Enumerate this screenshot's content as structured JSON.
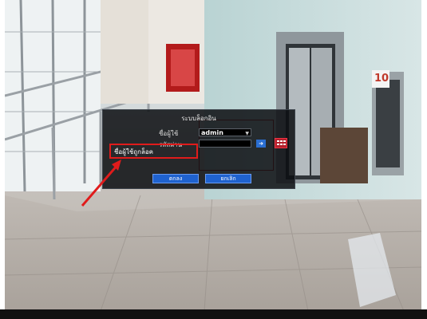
{
  "login": {
    "title": "ระบบล็อกอิน",
    "username_label": "ชื่อผู้ใช้",
    "username_value": "admin",
    "password_label": "รหัสผ่าน",
    "error_text": "ชื่อผู้ใช้ถูกล็อค",
    "ok_label": "ตกลง",
    "cancel_label": "ยกเลิก",
    "keyboard_icon": "keyboard-icon",
    "arrow_icon": "arrow-right-icon"
  },
  "scene": {
    "elevator_number": "10"
  },
  "colors": {
    "button_blue": "#1f62cf",
    "highlight_red": "#e01b1b"
  }
}
